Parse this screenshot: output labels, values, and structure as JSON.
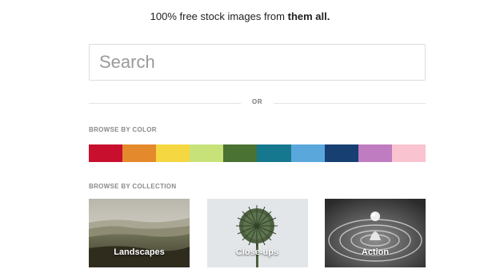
{
  "header": {
    "tagline_prefix": "100% free stock images from ",
    "tagline_bold": "them all."
  },
  "search": {
    "placeholder": "Search",
    "value": ""
  },
  "divider": {
    "label": "OR"
  },
  "browse_color": {
    "label": "BROWSE BY COLOR",
    "colors": [
      "#c8102e",
      "#e48a2c",
      "#f5d742",
      "#c8e27a",
      "#4a7233",
      "#16788f",
      "#5aa7dc",
      "#173f72",
      "#c07cc0",
      "#f9c4d0"
    ]
  },
  "browse_collection": {
    "label": "BROWSE BY COLLECTION",
    "items": [
      {
        "label": "Landscapes",
        "icon": "landscape-image"
      },
      {
        "label": "Close-ups",
        "icon": "thistle-image"
      },
      {
        "label": "Action",
        "icon": "water-drop-image"
      }
    ]
  }
}
